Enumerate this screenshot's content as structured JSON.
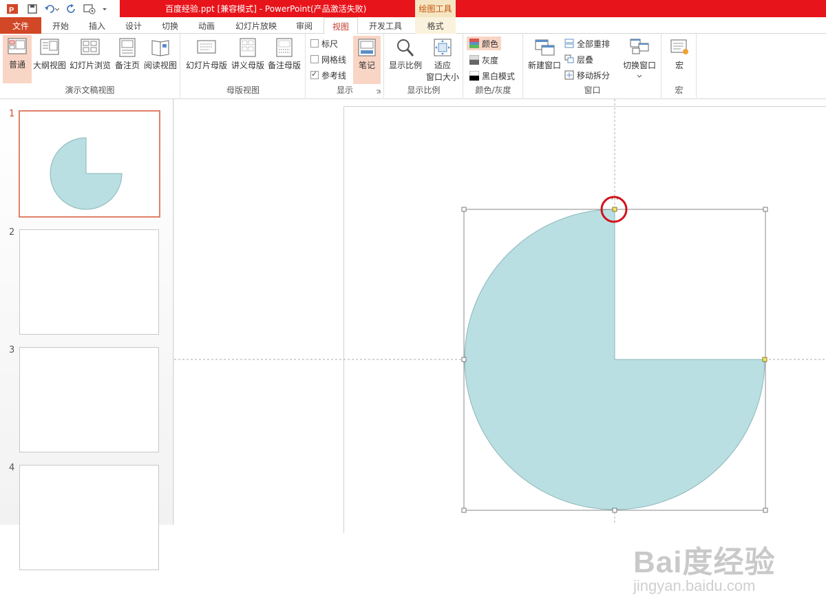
{
  "window": {
    "title": "百度经验.ppt [兼容模式] - PowerPoint(产品激活失败)",
    "context_tool": "绘图工具"
  },
  "tabs": [
    "文件",
    "开始",
    "插入",
    "设计",
    "切换",
    "动画",
    "幻灯片放映",
    "审阅",
    "视图",
    "开发工具",
    "格式"
  ],
  "active_tab": "视图",
  "ribbon": {
    "presentation_views": {
      "label": "演示文稿视图",
      "buttons": [
        "普通",
        "大纲视图",
        "幻灯片浏览",
        "备注页",
        "阅读视图"
      ]
    },
    "master_views": {
      "label": "母版视图",
      "buttons": [
        "幻灯片母版",
        "讲义母版",
        "备注母版"
      ]
    },
    "show": {
      "label": "显示",
      "ruler": "标尺",
      "gridlines": "网格线",
      "guides": "参考线",
      "notes": "笔记"
    },
    "zoom": {
      "label": "显示比例",
      "zoom_btn": "显示比例",
      "fit_line1": "适应",
      "fit_line2": "窗口大小"
    },
    "color": {
      "label": "颜色/灰度",
      "color": "颜色",
      "grayscale": "灰度",
      "bw": "黑白模式"
    },
    "window": {
      "label": "窗口",
      "new_window": "新建窗口",
      "arrange_all": "全部重排",
      "cascade": "层叠",
      "move_split": "移动拆分",
      "switch_window": "切换窗口"
    },
    "macros": {
      "label": "宏",
      "macros_btn": "宏"
    }
  },
  "slides": [
    {
      "number": "1",
      "selected": true
    },
    {
      "number": "2",
      "selected": false
    },
    {
      "number": "3",
      "selected": false
    },
    {
      "number": "4",
      "selected": false
    }
  ],
  "shape": {
    "type": "pie",
    "fill": "#b9dfe2",
    "stroke": "#8bb5b9",
    "missing_quadrant": "top-right"
  },
  "colors": {
    "accent": "#d24726",
    "title_bar": "#e8141b",
    "highlight_circle": "#d0111a"
  },
  "watermark": {
    "logo": "Bai度经验",
    "url": "jingyan.baidu.com"
  }
}
